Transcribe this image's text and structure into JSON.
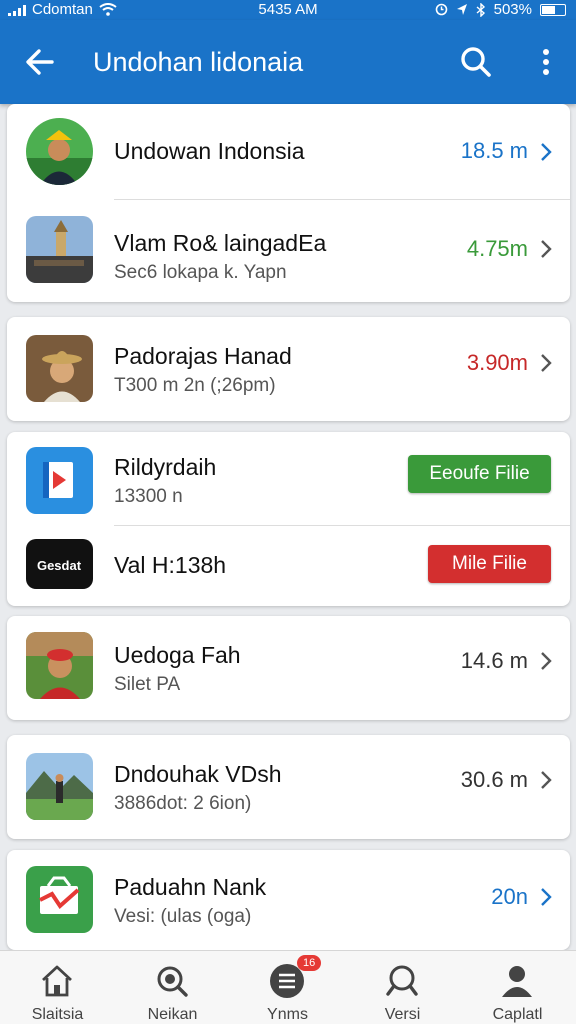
{
  "status_bar": {
    "carrier": "Cdomtan",
    "time": "5435 AM",
    "battery": "503%"
  },
  "app_bar": {
    "title": "Undohan lidonaia"
  },
  "items": [
    {
      "name": "Undowan Indonsia",
      "distance": "18.5 m"
    },
    {
      "name": "Vlam Ro& laingadEa",
      "sub": "Sec6 lokapa k. Yapn",
      "distance": "4.75m"
    },
    {
      "name": "Padorajas Hanad",
      "sub": "T300 m 2n (;26pm)",
      "distance": "3.90m"
    },
    {
      "name": "Rildyrdaih",
      "sub": "13300 n",
      "button": "Eeoufe Filie"
    },
    {
      "name": "Val H:138h",
      "button": "Mile Filie",
      "logo_text": "Gesdat"
    },
    {
      "name": "Uedoga Fah",
      "sub": "Silet PA",
      "distance": "14.6 m"
    },
    {
      "name": "Dndouhak VDsh",
      "sub": "3886dot: 2 6ion)",
      "distance": "30.6 m"
    },
    {
      "name": "Paduahn Nank",
      "sub": "Vesi: (ulas (oga)",
      "distance": "20n"
    }
  ],
  "colors": {
    "primary": "#1a73c8",
    "green": "#3a9a3a",
    "red": "#d32f2f",
    "blue_distance": "#1a73c8",
    "green_distance": "#3a9a3a",
    "red_distance": "#c62828"
  },
  "tabs": [
    {
      "label": "Slaitsia",
      "icon": "home-icon"
    },
    {
      "label": "Neikan",
      "icon": "search-icon"
    },
    {
      "label": "Ynms",
      "icon": "menu-list-icon",
      "badge": "16"
    },
    {
      "label": "Versi",
      "icon": "search-icon"
    },
    {
      "label": "Caplatl",
      "icon": "person-icon"
    }
  ]
}
